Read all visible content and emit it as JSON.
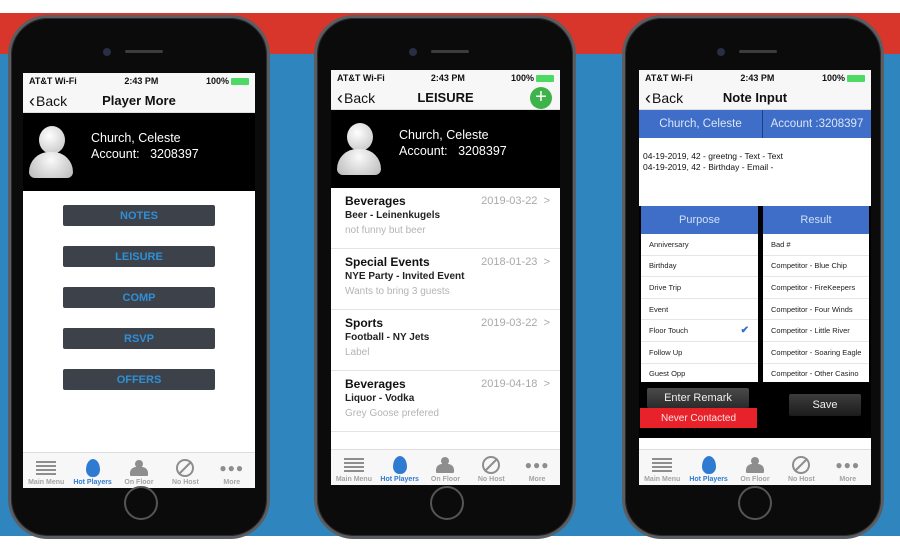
{
  "status_bar": {
    "carrier": "AT&T Wi-Fi",
    "time": "2:43 PM",
    "battery": "100%"
  },
  "player": {
    "name": "Church, Celeste",
    "account_label": "Account:",
    "account_number": "3208397"
  },
  "tabbar": {
    "items": [
      {
        "label": "Main Menu",
        "icon": "list-icon"
      },
      {
        "label": "Hot Players",
        "icon": "flame-icon",
        "active": true
      },
      {
        "label": "On Floor",
        "icon": "person-icon"
      },
      {
        "label": "No Host",
        "icon": "no-symbol-icon"
      },
      {
        "label": "More",
        "icon": "more-icon"
      }
    ]
  },
  "screen1": {
    "back_label": "Back",
    "title": "Player More",
    "buttons": [
      "NOTES",
      "LEISURE",
      "COMP",
      "RSVP",
      "OFFERS"
    ]
  },
  "screen2": {
    "back_label": "Back",
    "title": "LEISURE",
    "add_label": "+",
    "items": [
      {
        "category": "Beverages",
        "date": "2019-03-22",
        "detail": "Beer - Leinenkugels",
        "note": "not funny but beer"
      },
      {
        "category": "Special Events",
        "date": "2018-01-23",
        "detail": "NYE Party - Invited Event",
        "note": "Wants to bring 3 guests"
      },
      {
        "category": "Sports",
        "date": "2019-03-22",
        "detail": "Football - NY Jets",
        "note": "Label"
      },
      {
        "category": "Beverages",
        "date": "2019-04-18",
        "detail": "Liquor - Vodka",
        "note": "Grey Goose prefered"
      }
    ],
    "chevron": ">"
  },
  "screen3": {
    "back_label": "Back",
    "title": "Note Input",
    "header_name": "Church, Celeste",
    "header_account": "Account :3208397",
    "notes": [
      "04-19-2019, 42 - greetng - Text - Text",
      "04-19-2019, 42 - Birthday - Email -"
    ],
    "purpose_header": "Purpose",
    "result_header": "Result",
    "purposes": [
      "Anniversary",
      "Birthday",
      "Drive Trip",
      "Event",
      "Floor Touch",
      "Follow Up",
      "Guest Opp"
    ],
    "selected_purpose": "Floor Touch",
    "results": [
      "Bad #",
      "Competitor - Blue Chip",
      "Competitor - FireKeepers",
      "Competitor - Four Winds",
      "Competitor - Little River",
      "Competitor - Soaring Eagle",
      "Competitor - Other Casino"
    ],
    "enter_remark_label": "Enter Remark",
    "never_contacted_label": "Never Contacted",
    "save_label": "Save"
  },
  "colors": {
    "brand_red": "#d8362a",
    "brand_blue": "#2f86bf",
    "header_blue": "#3e6ec7",
    "button_text_blue": "#2f8fd6",
    "add_green": "#3db34a",
    "alert_red": "#e8222a"
  }
}
